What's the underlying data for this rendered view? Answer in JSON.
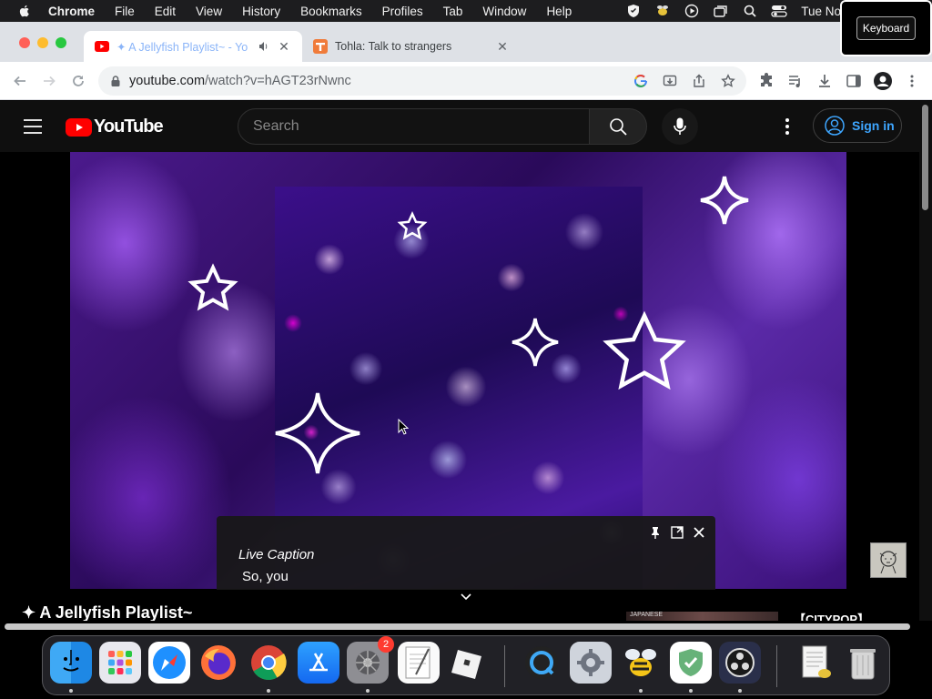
{
  "menubar": {
    "app": "Chrome",
    "items": [
      "File",
      "Edit",
      "View",
      "History",
      "Bookmarks",
      "Profiles",
      "Tab",
      "Window",
      "Help"
    ],
    "clock": "Tue No",
    "status_icons": [
      "shield-icon",
      "bee-icon",
      "play-circle-icon",
      "screens-icon",
      "search-icon",
      "control-center-icon"
    ]
  },
  "overlay": {
    "keyboard_label": "Keyboard"
  },
  "tabs": [
    {
      "title": "✦ A Jellyfish Playlist~ - Yo",
      "favicon": "youtube-icon",
      "audio": true,
      "active": true
    },
    {
      "title": "Tohla: Talk to strangers",
      "favicon": "tohla-icon",
      "active": false
    }
  ],
  "toolbar": {
    "url_host": "youtube.com",
    "url_path": "/watch?v=hAGT23rNwnc"
  },
  "youtube": {
    "logo_text": "YouTube",
    "search_placeholder": "Search",
    "signin_label": "Sign in",
    "video_title": "✦ A Jellyfish Playlist~",
    "side_title": "【CITYPOP】",
    "side_thumb_text": "JAPANESE"
  },
  "live_caption": {
    "title": "Live Caption",
    "text": "So, you"
  },
  "dock": {
    "apps": [
      "Finder",
      "Launchpad",
      "Safari",
      "Firefox",
      "Chrome",
      "App Store",
      "System Preferences",
      "TextEdit",
      "Roblox",
      "QuickTime",
      "Settings",
      "Bee",
      "AdGuard",
      "OBS",
      "Preview",
      "Trash"
    ],
    "settings_badge": "2"
  },
  "colors": {
    "youtube_red": "#ff0000",
    "link_blue": "#3ea6ff",
    "chrome_tabstrip": "#dee1e6"
  }
}
